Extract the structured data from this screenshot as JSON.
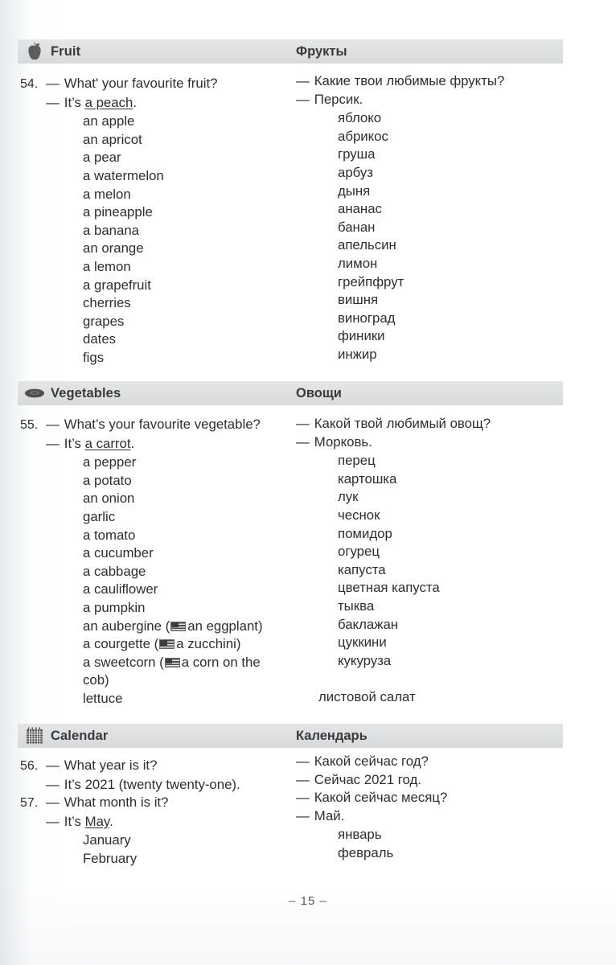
{
  "page": {
    "number_label": "– 15 –"
  },
  "sections": [
    {
      "id": "fruit",
      "icon": "apple-icon",
      "title_en": "Fruit",
      "title_ru": "Фрукты",
      "entries": [
        {
          "number": "54.",
          "question_en_dash": "—",
          "question_en": "What' your favourite fruit?",
          "answer_en_dash": "—",
          "answer_en_prefix": "It’s ",
          "answer_en_underlined": "a peach",
          "answer_en_suffix": ".",
          "question_ru_dash": "—",
          "question_ru": "Какие твои любимые фрукты?",
          "answer_ru_dash": "—",
          "answer_ru": "Персик."
        }
      ],
      "words_en": [
        "an apple",
        "an apricot",
        "a pear",
        "a watermelon",
        "a melon",
        "a pineapple",
        "a banana",
        "an orange",
        "a lemon",
        "a grapefruit",
        "cherries",
        "grapes",
        "dates",
        "figs"
      ],
      "words_ru": [
        "яблоко",
        "абрикос",
        "груша",
        "арбуз",
        "дыня",
        "ананас",
        "банан",
        "апельсин",
        "лимон",
        "грейпфрут",
        "вишня",
        "виноград",
        "финики",
        "инжир"
      ]
    },
    {
      "id": "vegetables",
      "icon": "eggplant-icon",
      "title_en": "Vegetables",
      "title_ru": "Овощи",
      "entries": [
        {
          "number": "55.",
          "question_en_dash": "—",
          "question_en": "What’s your favourite vegetable?",
          "answer_en_dash": "—",
          "answer_en_prefix": "It’s ",
          "answer_en_underlined": "a carrot",
          "answer_en_suffix": ".",
          "question_ru_dash": "—",
          "question_ru": "Какой твой любимый овощ?",
          "answer_ru_dash": "—",
          "answer_ru": "Морковь."
        }
      ],
      "words_en": [
        "a pepper",
        "a potato",
        "an onion",
        "garlic",
        "a tomato",
        "a cucumber",
        "a cabbage",
        "a cauliflower",
        "a pumpkin"
      ],
      "words_en_flagged": [
        {
          "before": "an aubergine (",
          "flag": "us-flag-icon",
          "after": "an eggplant)"
        },
        {
          "before": "a courgette (",
          "flag": "us-flag-icon",
          "after": "a zucchini)"
        },
        {
          "before": "a sweetcorn (",
          "flag": "us-flag-icon",
          "after": "a corn on the"
        }
      ],
      "words_en_tail": [
        "cob)",
        "lettuce"
      ],
      "words_ru": [
        "перец",
        "картошка",
        "лук",
        "чеснок",
        "помидор",
        "огурец",
        "капуста",
        "цветная капуста",
        "тыква",
        "баклажан",
        "цуккини",
        "кукуруза"
      ],
      "words_ru_tail": [
        "листовой салат"
      ]
    },
    {
      "id": "calendar",
      "icon": "calendar-icon",
      "title_en": "Calendar",
      "title_ru": "Календарь",
      "entries": [
        {
          "number": "56.",
          "question_en_dash": "—",
          "question_en": "What year is it?",
          "answer_en_dash": "—",
          "answer_en_plain": "It’s 2021 (twenty twenty-one).",
          "question_ru_dash": "—",
          "question_ru": "Какой сейчас год?",
          "answer_ru_dash": "—",
          "answer_ru": "Сейчас 2021 год."
        },
        {
          "number": "57.",
          "question_en_dash": "—",
          "question_en": "What month is it?",
          "answer_en_dash": "—",
          "answer_en_prefix": "It’s ",
          "answer_en_underlined": "May",
          "answer_en_suffix": ".",
          "question_ru_dash": "—",
          "question_ru": "Какой сейчас месяц?",
          "answer_ru_dash": "—",
          "answer_ru": "Май."
        }
      ],
      "words_en": [
        "January",
        "February"
      ],
      "words_ru": [
        "январь",
        "февраль"
      ]
    }
  ]
}
